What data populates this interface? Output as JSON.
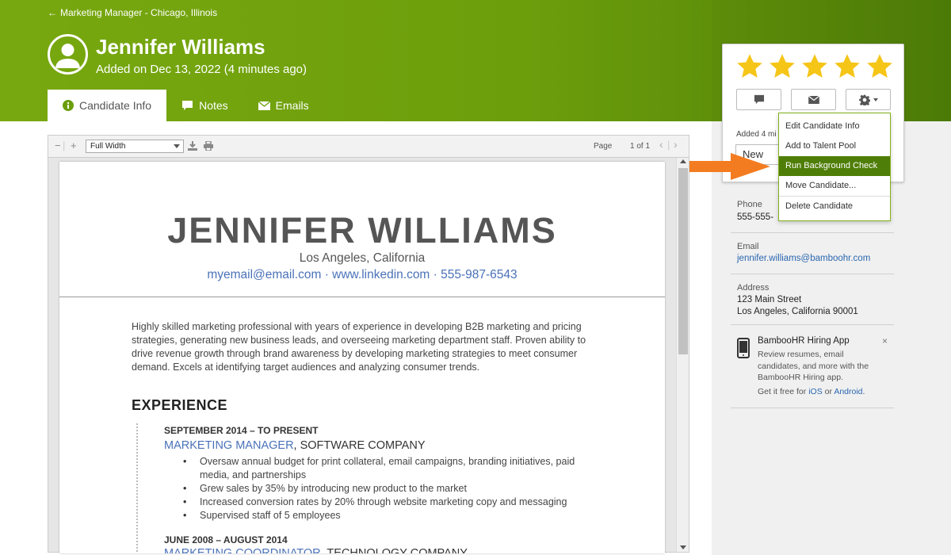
{
  "header": {
    "back_link": "Marketing Manager - Chicago, Illinois",
    "candidate_name": "Jennifer Williams",
    "added_on": "Added on Dec 13, 2022 (4 minutes ago)",
    "tabs": [
      {
        "label": "Candidate Info",
        "icon": "info-icon",
        "active": true
      },
      {
        "label": "Notes",
        "icon": "speech-bubble-icon"
      },
      {
        "label": "Emails",
        "icon": "envelope-icon"
      }
    ]
  },
  "colors": {
    "brand_green": "#6c9e0c",
    "dark_green": "#4f7e08",
    "star": "#f5c518",
    "link": "#2a67b1",
    "arrow": "#f47c20"
  },
  "rating": {
    "stars": 5,
    "max": 5
  },
  "card": {
    "added_text": "Added 4 mi",
    "status": "New"
  },
  "menu": {
    "items": [
      "Edit Candidate Info",
      "Add to Talent Pool",
      "Run Background Check",
      "Move Candidate...",
      "Delete Candidate"
    ],
    "highlighted": "Run Background Check"
  },
  "contact": {
    "phone_label": "Phone",
    "phone": "555-555-",
    "email_label": "Email",
    "email": "jennifer.williams@bamboohr.com",
    "address_label": "Address",
    "address_line1": "123 Main Street",
    "address_line2": "Los Angeles, California 90001"
  },
  "promo": {
    "title": "BambooHR Hiring App",
    "desc": "Review resumes, email candidates, and more with the BambooHR Hiring app.",
    "get_prefix": "Get it free for",
    "ios": "iOS",
    "or": "or",
    "android": "Android",
    "period": ".",
    "close": "×"
  },
  "viewer": {
    "zoom": "Full Width",
    "page_label": "Page",
    "page_count": "1 of 1"
  },
  "resume": {
    "name": "JENNIFER WILLIAMS",
    "location": "Los Angeles, California",
    "contact": "myemail@email.com · www.linkedin.com · 555-987-6543",
    "summary": "Highly skilled marketing professional with years of experience in developing B2B marketing and pricing strategies, generating new business leads, and overseeing marketing department staff. Proven ability to drive revenue growth through brand awareness by developing marketing strategies to meet consumer demand. Excels at identifying target audiences and analyzing consumer trends.",
    "experience_heading": "EXPERIENCE",
    "jobs": [
      {
        "dates": "SEPTEMBER 2014 – TO PRESENT",
        "title": "MARKETING MANAGER",
        "company": ", SOFTWARE COMPANY",
        "bullets": [
          "Oversaw annual budget for print collateral, email campaigns, branding initiatives, paid media, and partnerships",
          "Grew sales by 35% by introducing new product to the market",
          "Increased conversion rates by 20% through website marketing copy and messaging",
          "Supervised staff of 5 employees"
        ]
      },
      {
        "dates": "JUNE 2008 – AUGUST 2014",
        "title": "MARKETING COORDINATOR",
        "company": ", TECHNOLOGY COMPANY"
      }
    ]
  }
}
